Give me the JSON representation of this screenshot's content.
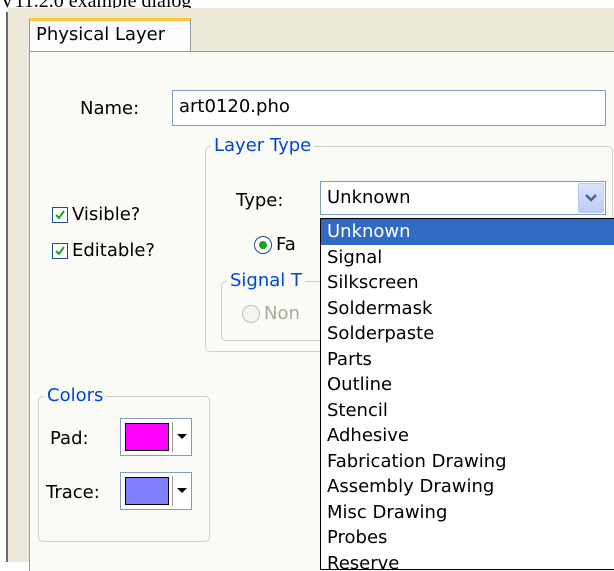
{
  "caption": "V11.2.0 example dialog",
  "tab": {
    "label": "Physical Layer"
  },
  "name": {
    "label": "Name:",
    "value": "art0120.pho"
  },
  "options": {
    "visible": {
      "label": "Visible?",
      "checked": true
    },
    "editable": {
      "label": "Editable?",
      "checked": true
    }
  },
  "layer_type": {
    "legend": "Layer Type",
    "type_label": "Type:",
    "selected": "Unknown",
    "radio_partial": "Fa",
    "items": [
      "Unknown",
      "Signal",
      "Silkscreen",
      "Soldermask",
      "Solderpaste",
      "Parts",
      "Outline",
      "Stencil",
      "Adhesive",
      "Fabrication Drawing",
      "Assembly Drawing",
      "Misc Drawing",
      "Probes",
      "Reserve"
    ]
  },
  "signal_type": {
    "legend_partial": "Signal T",
    "radio_partial": "Non"
  },
  "colors": {
    "legend": "Colors",
    "pad": {
      "label": "Pad:",
      "color": "#ff00ff"
    },
    "trace": {
      "label": "Trace:",
      "color": "#8080ff"
    }
  }
}
